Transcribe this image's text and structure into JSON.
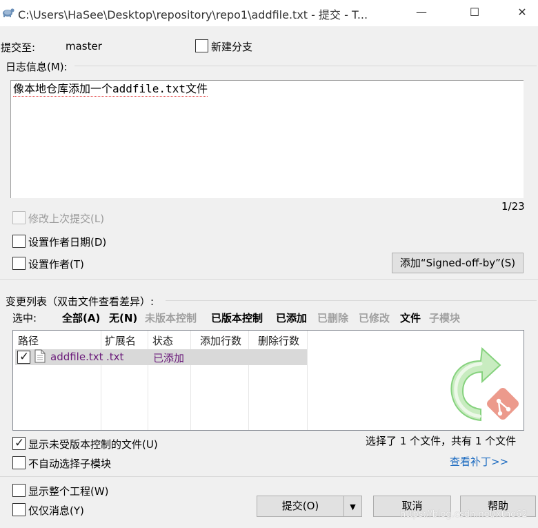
{
  "window": {
    "title": "C:\\Users\\HaSee\\Desktop\\repository\\repo1\\addfile.txt - 提交 - T...",
    "minimize_glyph": "—",
    "maximize_glyph": "☐",
    "close_glyph": "✕"
  },
  "commit_to": {
    "label": "提交至:",
    "branch": "master"
  },
  "new_branch": {
    "label": "新建分支",
    "checked": false
  },
  "message": {
    "label": "日志信息(M):",
    "text": "像本地仓库添加一个addfile.txt文件",
    "counter": "1/23"
  },
  "options": {
    "amend": {
      "label": "修改上次提交(L)",
      "checked": false,
      "disabled": true
    },
    "set_date": {
      "label": "设置作者日期(D)",
      "checked": false
    },
    "set_author": {
      "label": "设置作者(T)",
      "checked": false
    }
  },
  "signed_off_button": "添加“Signed-off-by”(S)",
  "changes": {
    "label": "变更列表（双击文件查看差异）:",
    "select_label": "选中:",
    "filters": [
      {
        "label": "全部(A)",
        "enabled": true
      },
      {
        "label": "无(N)",
        "enabled": true
      },
      {
        "label": "未版本控制",
        "enabled": false
      },
      {
        "label": "已版本控制",
        "enabled": true
      },
      {
        "label": "已添加",
        "enabled": true
      },
      {
        "label": "已删除",
        "enabled": false
      },
      {
        "label": "已修改",
        "enabled": false
      },
      {
        "label": "文件",
        "enabled": true
      },
      {
        "label": "子模块",
        "enabled": false
      }
    ],
    "columns": [
      "路径",
      "扩展名",
      "状态",
      "添加行数",
      "删除行数"
    ],
    "rows": [
      {
        "checked": true,
        "path": "addfile.txt",
        "ext": ".txt",
        "status": "已添加",
        "added": "",
        "deleted": ""
      }
    ],
    "summary": "选择了 1 个文件，共有 1 个文件",
    "show_unversioned": {
      "label": "显示未受版本控制的文件(U)",
      "checked": true
    },
    "no_autoselect": {
      "label": "不自动选择子模块",
      "checked": false
    },
    "view_patch": "查看补丁>>"
  },
  "bottom": {
    "show_project": {
      "label": "显示整个工程(W)",
      "checked": false
    },
    "message_only": {
      "label": "仅仅消息(Y)",
      "checked": false
    },
    "commit_button": "提交(O)",
    "cancel_button": "取消",
    "help_button": "帮助"
  },
  "watermark": "https://blog.csdn.net/xtho62",
  "colors": {
    "status_added": "#6a1a7a",
    "link": "#1b6ac0",
    "logo_green": "#5fc45a",
    "git_red": "#e8624e"
  }
}
